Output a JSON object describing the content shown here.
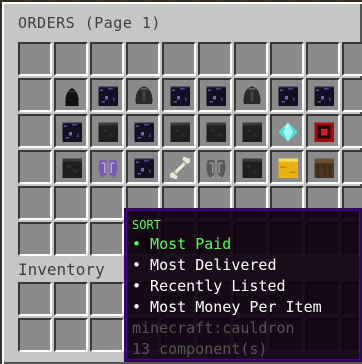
{
  "title": "ORDERS (Page 1)",
  "inventory_label": "Inventory",
  "tooltip": {
    "header": "SORT",
    "options": [
      {
        "text": "• Most Paid",
        "active": true
      },
      {
        "text": "• Most Delivered",
        "active": false
      },
      {
        "text": "• Recently Listed",
        "active": false
      },
      {
        "text": "• Most Money Per Item",
        "active": false
      }
    ],
    "item_id": "minecraft:cauldron",
    "components": "13 component(s)"
  },
  "rows": [
    [
      "",
      "",
      "",
      "",
      "",
      "",
      "",
      "",
      "",
      ""
    ],
    [
      "",
      "black-dye-icon",
      "obsidian-block-icon",
      "black-helmet-icon",
      "obsidian-block-icon",
      "obsidian-block-icon",
      "black-helmet-icon",
      "obsidian-block-icon",
      "obsidian-block-icon",
      ""
    ],
    [
      "",
      "obsidian-block-icon",
      "coal-block-icon",
      "obsidian-block-icon",
      "coal-block-icon",
      "coal-block-icon",
      "coal-block-icon",
      "diamond-icon",
      "redstone-block-icon",
      ""
    ],
    [
      "",
      "coal-block-icon",
      "elytra-purple-icon",
      "obsidian-block-icon",
      "bone-icon",
      "elytra-grey-icon",
      "coal-block-icon",
      "gold-block-icon",
      "log-block-icon",
      ""
    ],
    [
      "",
      "",
      "",
      "",
      "",
      "",
      "",
      "",
      "",
      ""
    ],
    [
      "",
      "",
      "",
      "cauldron-icon",
      "",
      "",
      "",
      "",
      "",
      ""
    ]
  ]
}
